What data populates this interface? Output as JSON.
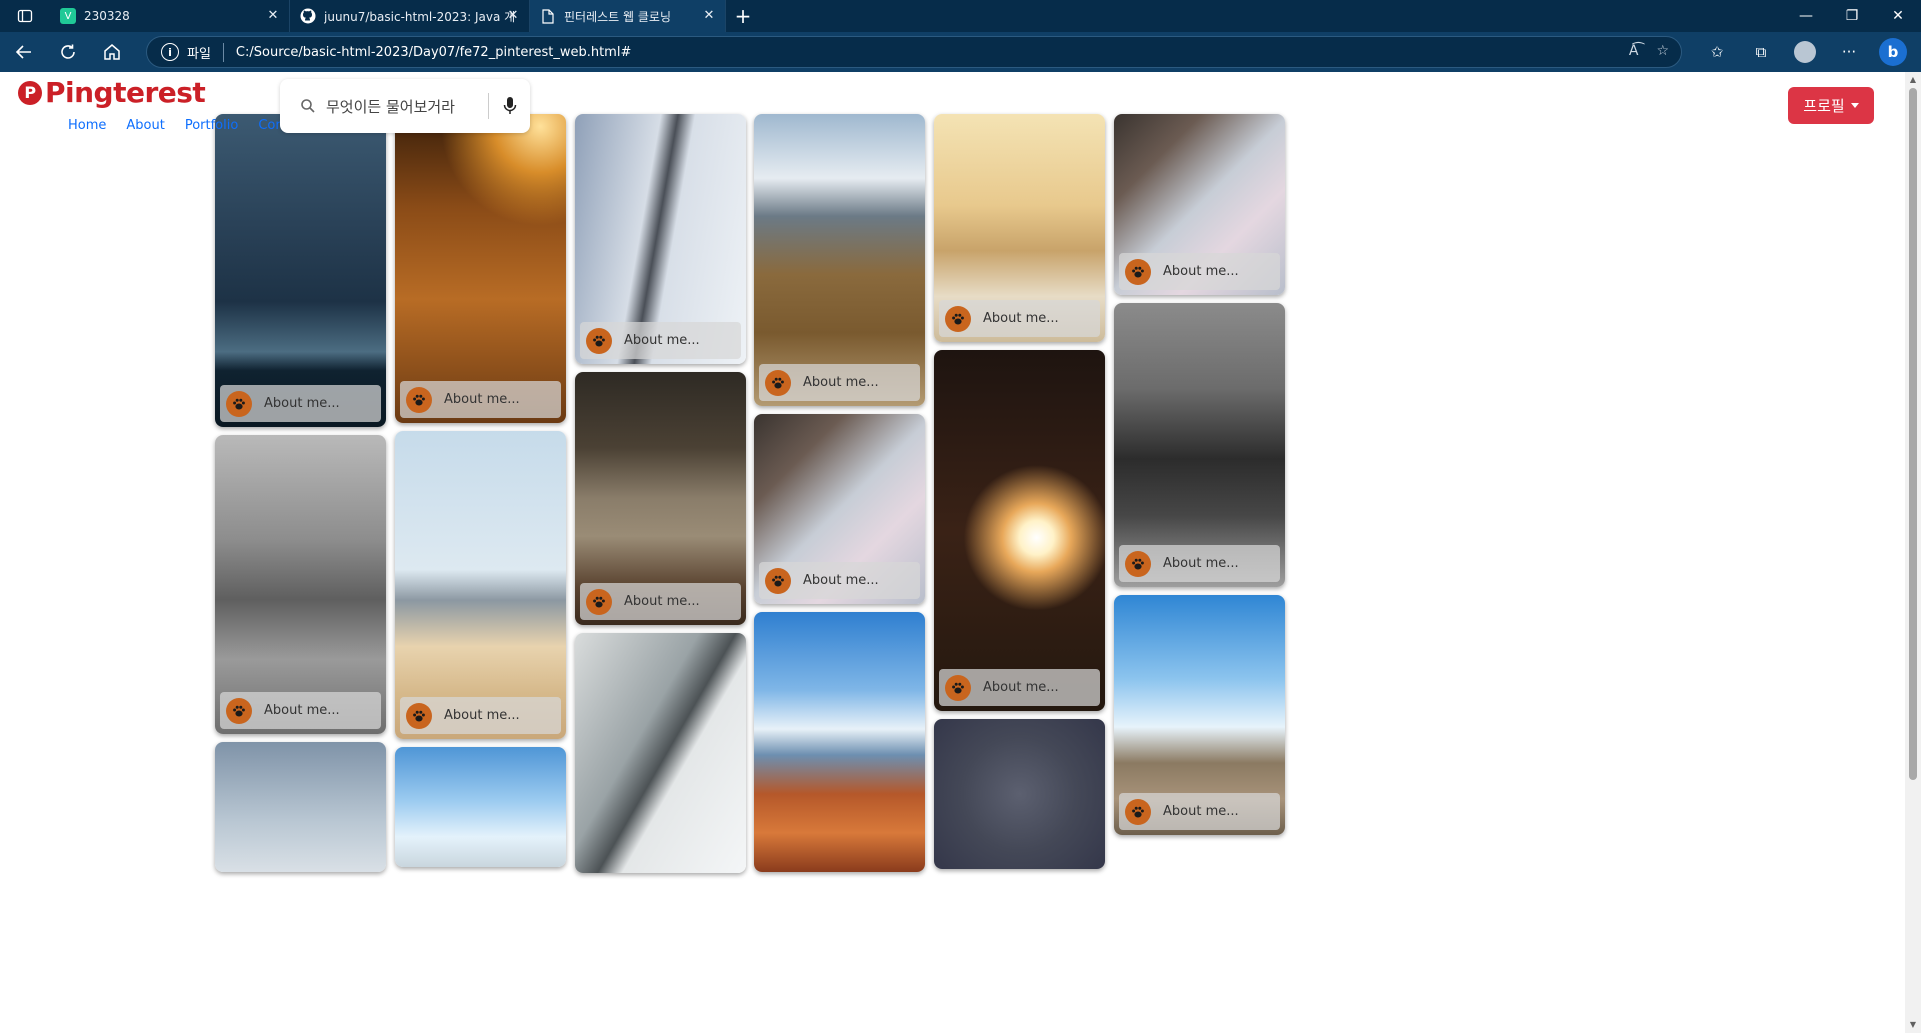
{
  "browser": {
    "tabs": [
      {
        "title": "230328",
        "favicon": "velog-icon",
        "favicon_color": "#20c997"
      },
      {
        "title": "juunu7/basic-html-2023: Java 개",
        "favicon": "github-icon",
        "favicon_color": "#ffffff"
      },
      {
        "title": "핀터레스트 웹 클로닝",
        "favicon": "page-icon",
        "favicon_color": "#ffffff"
      }
    ],
    "active_tab": 2,
    "address": {
      "scheme_label": "파일",
      "url": "C:/Source/basic-html-2023/Day07/fe72_pinterest_web.html#"
    }
  },
  "page": {
    "logo": "Pingterest",
    "logo_color": "#cb2027",
    "nav": [
      "Home",
      "About",
      "Portfolio",
      "Contact"
    ],
    "search": {
      "placeholder": "무엇이든 물어보거라"
    },
    "profile_button": "프로필",
    "profile_button_color": "#dc3545",
    "card_caption": "About me..."
  },
  "cards": [
    {
      "col": 0,
      "theme": "stormy-sea",
      "caption": "About me..."
    },
    {
      "col": 0,
      "theme": "foggy-forest",
      "caption": "About me..."
    },
    {
      "col": 0,
      "theme": "hazy-sky",
      "caption": ""
    },
    {
      "col": 1,
      "theme": "golden-grass",
      "caption": "About me..."
    },
    {
      "col": 1,
      "theme": "white-building",
      "caption": "About me..."
    },
    {
      "col": 1,
      "theme": "blue-pier",
      "caption": ""
    },
    {
      "col": 2,
      "theme": "tower-sky",
      "caption": "About me..."
    },
    {
      "col": 2,
      "theme": "coyote",
      "caption": "About me..."
    },
    {
      "col": 2,
      "theme": "sail",
      "caption": ""
    },
    {
      "col": 3,
      "theme": "mountains",
      "caption": "About me..."
    },
    {
      "col": 3,
      "theme": "baby",
      "caption": "About me..."
    },
    {
      "col": 3,
      "theme": "canyon",
      "caption": ""
    },
    {
      "col": 4,
      "theme": "woman-flowers",
      "caption": "About me..."
    },
    {
      "col": 4,
      "theme": "sparkler",
      "caption": "About me..."
    },
    {
      "col": 4,
      "theme": "star-trails",
      "caption": ""
    },
    {
      "col": 5,
      "theme": "baby",
      "caption": "About me..."
    },
    {
      "col": 5,
      "theme": "pinecone",
      "caption": "About me..."
    },
    {
      "col": 5,
      "theme": "pier",
      "caption": "About me..."
    }
  ]
}
